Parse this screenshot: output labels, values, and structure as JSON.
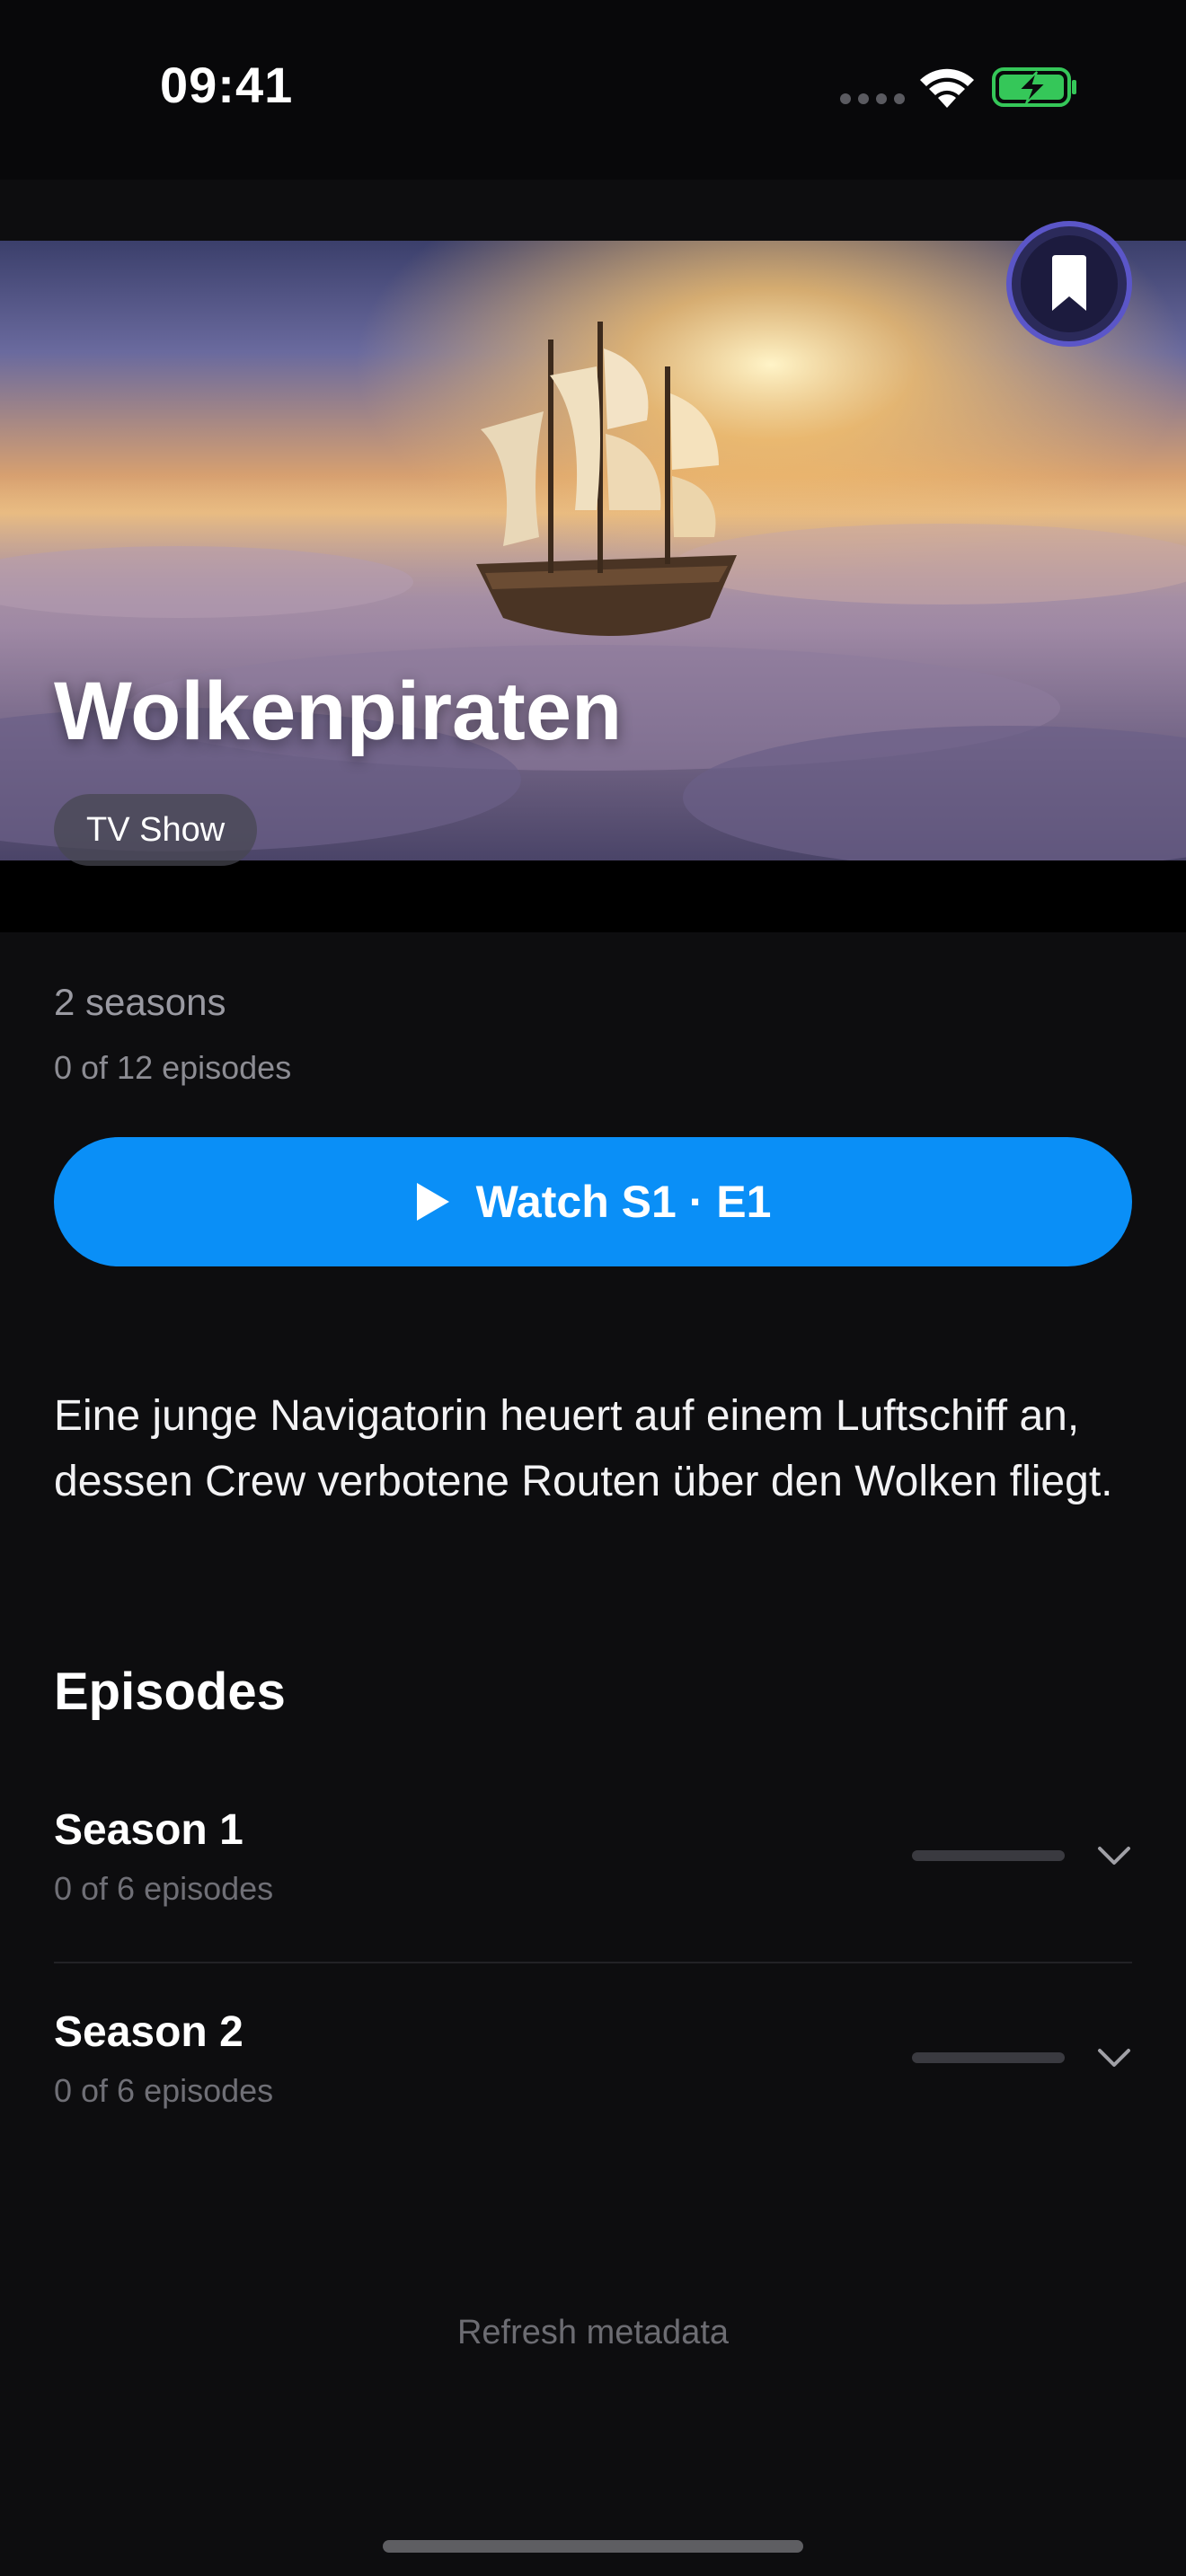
{
  "status_bar": {
    "time": "09:41",
    "wifi_icon": "wifi-icon",
    "battery_icon": "battery-charging-icon",
    "battery_color": "#35c759"
  },
  "hero": {
    "title": "Wolkenpiraten",
    "type_badge": "TV Show",
    "bookmark_icon": "bookmark-icon",
    "bookmark_color": "#5b56c8"
  },
  "summary": {
    "seasons": "2 seasons",
    "progress": "0 of 12 episodes"
  },
  "watch_button": {
    "icon": "play-icon",
    "label": "Watch S1 · E1",
    "color": "#0a8ff7"
  },
  "description": "Eine junge Navigatorin heuert auf einem Luftschiff an, dessen Crew verbotene Routen über den Wolken fliegt.",
  "episodes": {
    "title": "Episodes",
    "seasons": [
      {
        "title": "Season 1",
        "progress": "0 of 6 episodes",
        "watched_fraction": 0.0
      },
      {
        "title": "Season 2",
        "progress": "0 of 6 episodes",
        "watched_fraction": 0.0
      }
    ]
  },
  "footer": {
    "refresh_label": "Refresh metadata"
  }
}
